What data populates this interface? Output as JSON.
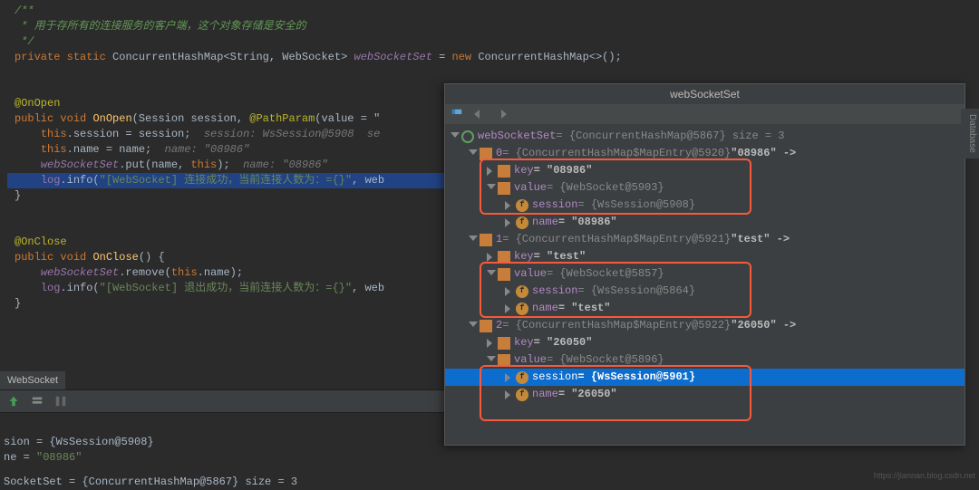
{
  "code": {
    "comment1": "/**",
    "comment2": " * 用于存所有的连接服务的客户端，这个对象存储是安全的",
    "comment3": " */",
    "decl_priv": "private",
    "decl_static": "static",
    "decl_type": "ConcurrentHashMap<String, WebSocket>",
    "decl_var": "webSocketSet",
    "decl_new": "new",
    "decl_ctor": "ConcurrentHashMap<>();",
    "onopen_anno": "@OnOpen",
    "onopen_sig1": "public",
    "onopen_sig2": "void",
    "onopen_name": "OnOpen",
    "onopen_args": "(Session session, ",
    "onopen_path": "@PathParam",
    "onopen_pathv": "(value = \"",
    "onopen_l1a": "this",
    "onopen_l1b": ".session = session;",
    "onopen_l1hint": "  session: WsSession@5908  se",
    "onopen_l2a": "this",
    "onopen_l2b": ".name = name;",
    "onopen_l2hint": "  name: \"08986\"",
    "onopen_l3a": "webSocketSet",
    "onopen_l3b": ".put(name, ",
    "onopen_l3c": "this",
    "onopen_l3d": ");",
    "onopen_l3hint": "  name: \"08986\"",
    "onopen_l4a": "log",
    "onopen_l4b": ".info(",
    "onopen_l4str": "\"[WebSocket] 连接成功，当前连接人数为：={}\"",
    "onopen_l4c": ", web",
    "onclose_anno": "@OnClose",
    "onclose_sig1": "public",
    "onclose_sig2": "void",
    "onclose_name": "OnClose",
    "onclose_args": "() {",
    "onclose_l1a": "webSocketSet",
    "onclose_l1b": ".remove(",
    "onclose_l1c": "this",
    "onclose_l1d": ".name);",
    "onclose_l2a": "log",
    "onclose_l2b": ".info(",
    "onclose_l2str": "\"[WebSocket] 退出成功，当前连接人数为：={}\"",
    "onclose_l2c": ", web"
  },
  "tab": {
    "label": "WebSocket"
  },
  "bottom": {
    "l1": "sion = {WsSession@5908}",
    "l2a": "ne = ",
    "l2b": "\"08986\"",
    "l3a": "SocketSet = ",
    "l3b": "{ConcurrentHashMap@5867}  size = 3"
  },
  "popup": {
    "title": "webSocketSet",
    "root_name": "webSocketSet",
    "root_val": " = {ConcurrentHashMap@5867}  size = 3",
    "e0_idx": "0",
    "e0_val": " = {ConcurrentHashMap$MapEntry@5920} ",
    "e0_tail": "\"08986\" ->",
    "e0_key_n": "key",
    "e0_key_v": " = \"08986\"",
    "e0_val_n": "value",
    "e0_val_v": " = {WebSocket@5903}",
    "e0_sess_n": "session",
    "e0_sess_v": " = {WsSession@5908}",
    "e0_name_n": "name",
    "e0_name_v": " = \"08986\"",
    "e1_idx": "1",
    "e1_val": " = {ConcurrentHashMap$MapEntry@5921} ",
    "e1_tail": "\"test\" ->",
    "e1_key_n": "key",
    "e1_key_v": " = \"test\"",
    "e1_val_n": "value",
    "e1_val_v": " = {WebSocket@5857}",
    "e1_sess_n": "session",
    "e1_sess_v": " = {WsSession@5864}",
    "e1_name_n": "name",
    "e1_name_v": " = \"test\"",
    "e2_idx": "2",
    "e2_val": " = {ConcurrentHashMap$MapEntry@5922} ",
    "e2_tail": "\"26050\" ->",
    "e2_key_n": "key",
    "e2_key_v": " = \"26050\"",
    "e2_val_n": "value",
    "e2_val_v": " = {WebSocket@5896}",
    "e2_sess_n": "session",
    "e2_sess_v": " = {WsSession@5901}",
    "e2_name_n": "name",
    "e2_name_v": " = \"26050\""
  },
  "side": {
    "label1": "Database"
  },
  "watermark": "https://jiannan.blog.csdn.net"
}
